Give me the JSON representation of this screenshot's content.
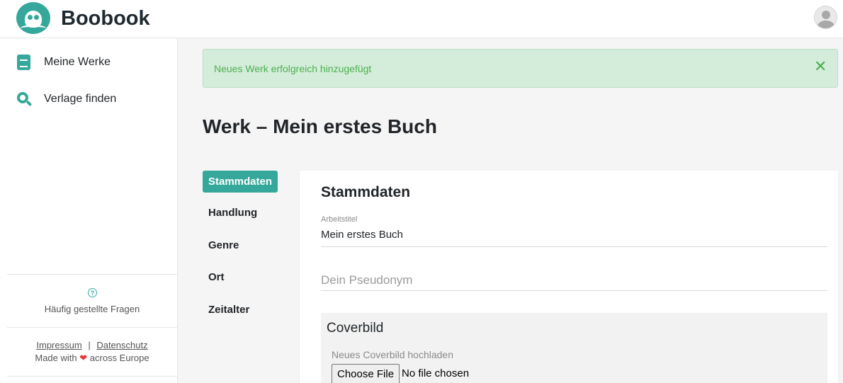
{
  "app": {
    "name": "Boobook",
    "accent_color": "#35a89b"
  },
  "sidebar": {
    "items": [
      {
        "label": "Meine Werke",
        "icon": "book-icon"
      },
      {
        "label": "Verlage finden",
        "icon": "search-icon"
      }
    ],
    "faq_icon": "question-circle-icon",
    "faq_label": "Häufig gestellte Fragen",
    "impressum": "Impressum",
    "separator": "|",
    "datenschutz": "Datenschutz",
    "made_with_prefix": "Made with",
    "made_with_suffix": "across Europe",
    "heart_icon": "heart-icon"
  },
  "alert": {
    "text": "Neues Werk erfolgreich hinzugefügt",
    "close_icon": "close-icon",
    "close_glyph": "✕",
    "color": "#4caf50"
  },
  "page": {
    "title": "Werk – Mein erstes Buch"
  },
  "tabs": [
    {
      "label": "Stammdaten",
      "active": true
    },
    {
      "label": "Handlung",
      "active": false
    },
    {
      "label": "Genre",
      "active": false
    },
    {
      "label": "Ort",
      "active": false
    },
    {
      "label": "Zeitalter",
      "active": false
    }
  ],
  "form": {
    "title": "Stammdaten",
    "arbeitstitel_label": "Arbeitstitel",
    "arbeitstitel_value": "Mein erstes Buch",
    "pseudonym_placeholder": "Dein Pseudonym",
    "pseudonym_value": "",
    "cover_title": "Coverbild",
    "cover_label": "Neues Coverbild hochladen",
    "file_button": "Choose File",
    "file_status": "No file chosen"
  }
}
